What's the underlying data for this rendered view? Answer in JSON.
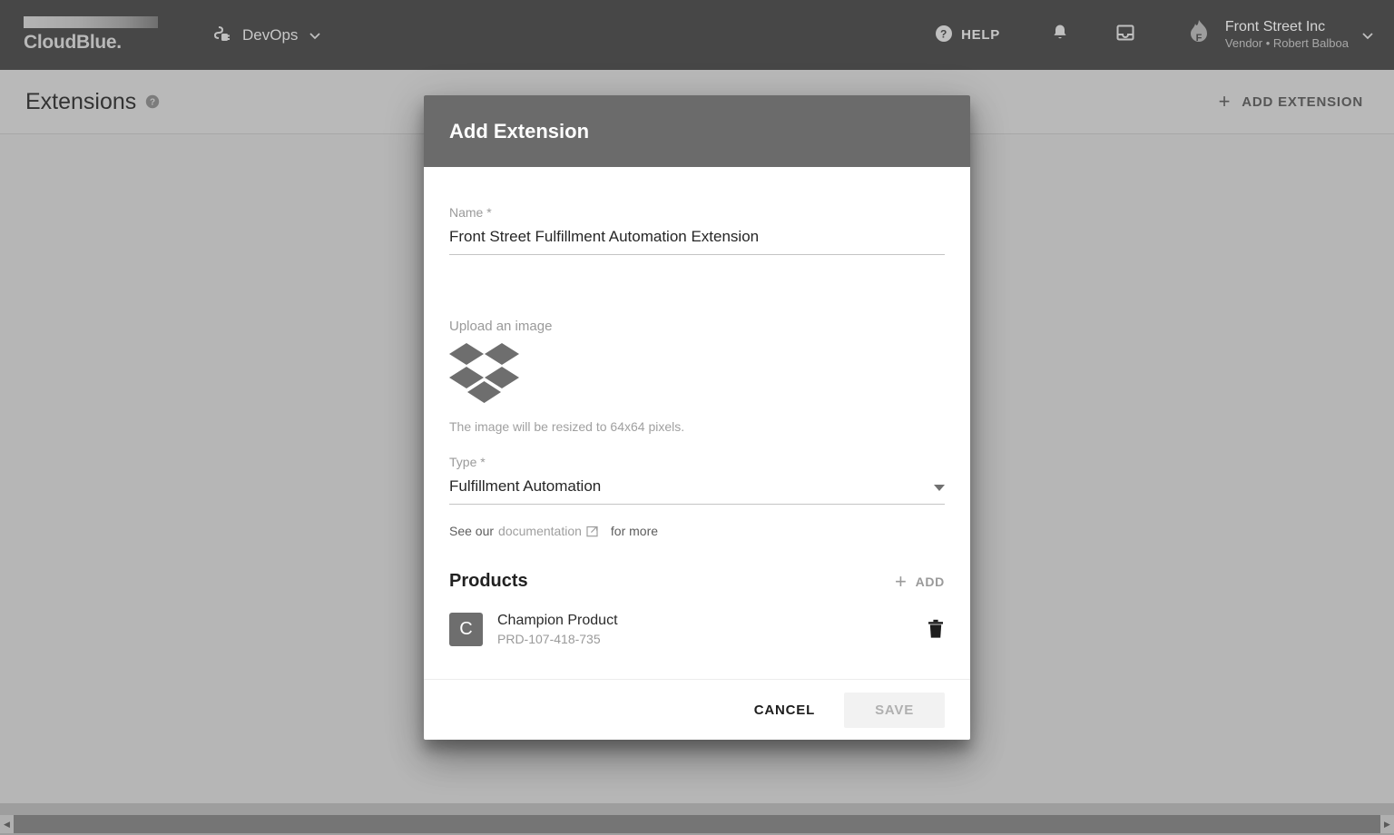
{
  "topbar": {
    "logo_text": "CloudBlue.",
    "logo_icon": "cloudblue-logo",
    "devops": {
      "label": "DevOps",
      "icon": "plug-icon",
      "chevron": "chevron-down-icon"
    },
    "help": {
      "label": "HELP",
      "icon": "help-circle-icon"
    },
    "notifications_icon": "bell-icon",
    "inbox_icon": "inbox-icon",
    "account": {
      "avatar_icon": "flame-avatar-icon",
      "name": "Front Street Inc",
      "subtitle": "Vendor • Robert Balboa",
      "chevron": "chevron-down-icon"
    }
  },
  "page": {
    "title": "Extensions",
    "title_help_icon": "help-circle-icon",
    "add_extension": {
      "label": "ADD EXTENSION",
      "icon": "plus-icon"
    }
  },
  "dialog": {
    "title": "Add Extension",
    "name_field": {
      "label": "Name *",
      "value": "Front Street Fulfillment Automation Extension",
      "placeholder": "Name"
    },
    "upload": {
      "label": "Upload an image",
      "icon": "dropbox-logo-icon",
      "hint": "The image will be resized to 64x64 pixels."
    },
    "type_field": {
      "label": "Type *",
      "value": "Fulfillment Automation",
      "caret_icon": "dropdown-caret-icon"
    },
    "doc_note": {
      "prefix": "See our",
      "link": "documentation",
      "link_icon": "external-link-icon",
      "suffix": "for more"
    },
    "products": {
      "title": "Products",
      "add_label": "ADD",
      "add_icon": "plus-icon",
      "items": [
        {
          "initial": "C",
          "name": "Champion Product",
          "id": "PRD-107-418-735",
          "delete_icon": "trash-icon"
        }
      ]
    },
    "footer": {
      "cancel_label": "CANCEL",
      "save_label": "SAVE",
      "save_disabled": true
    }
  },
  "scrollbar": {
    "left_arrow_icon": "chevron-left-icon",
    "right_arrow_icon": "chevron-right-icon"
  },
  "colors": {
    "topbar_bg": "#474747",
    "dialog_header_bg": "#6b6b6b",
    "overlay": "#9a9a9a",
    "avatar_bg": "#6e6e6e",
    "disabled_btn_bg": "#f2f2f2"
  }
}
